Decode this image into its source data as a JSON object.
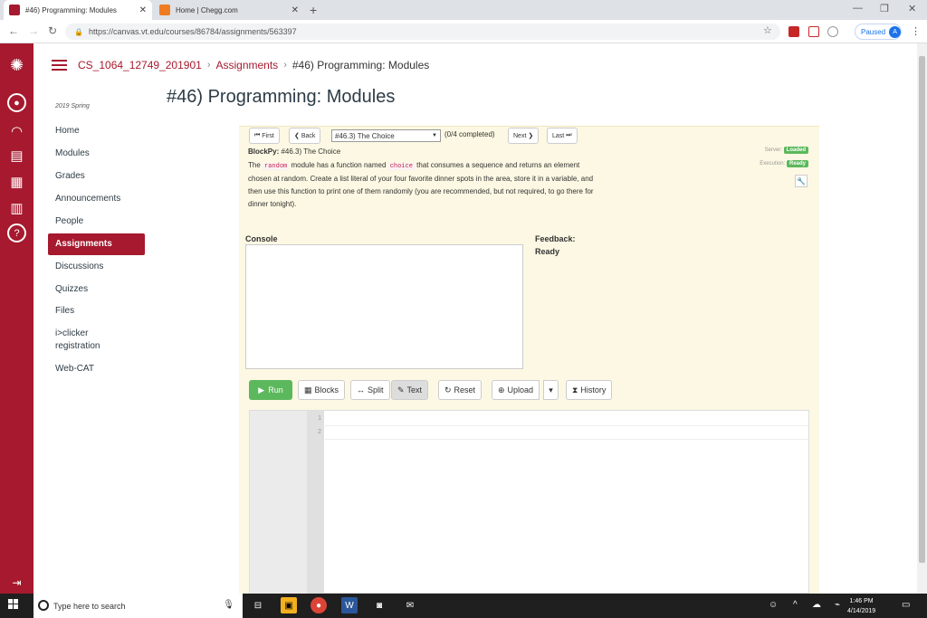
{
  "browser": {
    "tabs": [
      {
        "title": "#46) Programming: Modules",
        "active": true
      },
      {
        "title": "Home | Chegg.com",
        "active": false
      }
    ],
    "url": "https://canvas.vt.edu/courses/86784/assignments/563397",
    "profile_status": "Paused",
    "profile_initial": "A"
  },
  "breadcrumb": {
    "course": "CS_1064_12749_201901",
    "section": "Assignments",
    "current": "#46) Programming: Modules"
  },
  "page_title": "#46) Programming: Modules",
  "course_nav": {
    "term": "2019 Spring",
    "items": [
      "Home",
      "Modules",
      "Grades",
      "Announcements",
      "People",
      "Assignments",
      "Discussions",
      "Quizzes",
      "Files",
      "i>clicker",
      "registration",
      "Web-CAT"
    ],
    "active": "Assignments"
  },
  "blockpy": {
    "nav": {
      "first": "First",
      "back": "Back",
      "problem": "#46.3) The Choice",
      "completed": "(0/4 completed)",
      "next": "Next",
      "last": "Last"
    },
    "title_prefix": "BlockPy:",
    "title": "#46.3) The Choice",
    "desc": {
      "p1": "The",
      "c1": "random",
      "p2": "module has a function named",
      "c2": "choice",
      "p3": "that consumes a sequence and returns an element",
      "line2": "chosen at random. Create a list literal of your four favorite dinner spots in the area, store it in a variable, and",
      "line3": "then use this function to print one of them randomly (you are recommended, but not required, to go there for",
      "line4": "dinner tonight)."
    },
    "server_label": "Server:",
    "server_status": "Loaded",
    "execution_label": "Execution:",
    "execution_status": "Ready",
    "console_label": "Console",
    "feedback_label": "Feedback:",
    "feedback_status": "Ready",
    "toolbar": {
      "run": "Run",
      "blocks": "Blocks",
      "split": "Split",
      "text": "Text",
      "reset": "Reset",
      "upload": "Upload",
      "history": "History"
    },
    "line_numbers": [
      "1",
      "2"
    ]
  },
  "taskbar": {
    "search_placeholder": "Type here to search",
    "time": "1:46 PM",
    "date": "4/14/2019"
  },
  "colors": {
    "brand": "#a6192e",
    "panel_bg": "#fcf8e3",
    "run_green": "#5cb85c"
  }
}
